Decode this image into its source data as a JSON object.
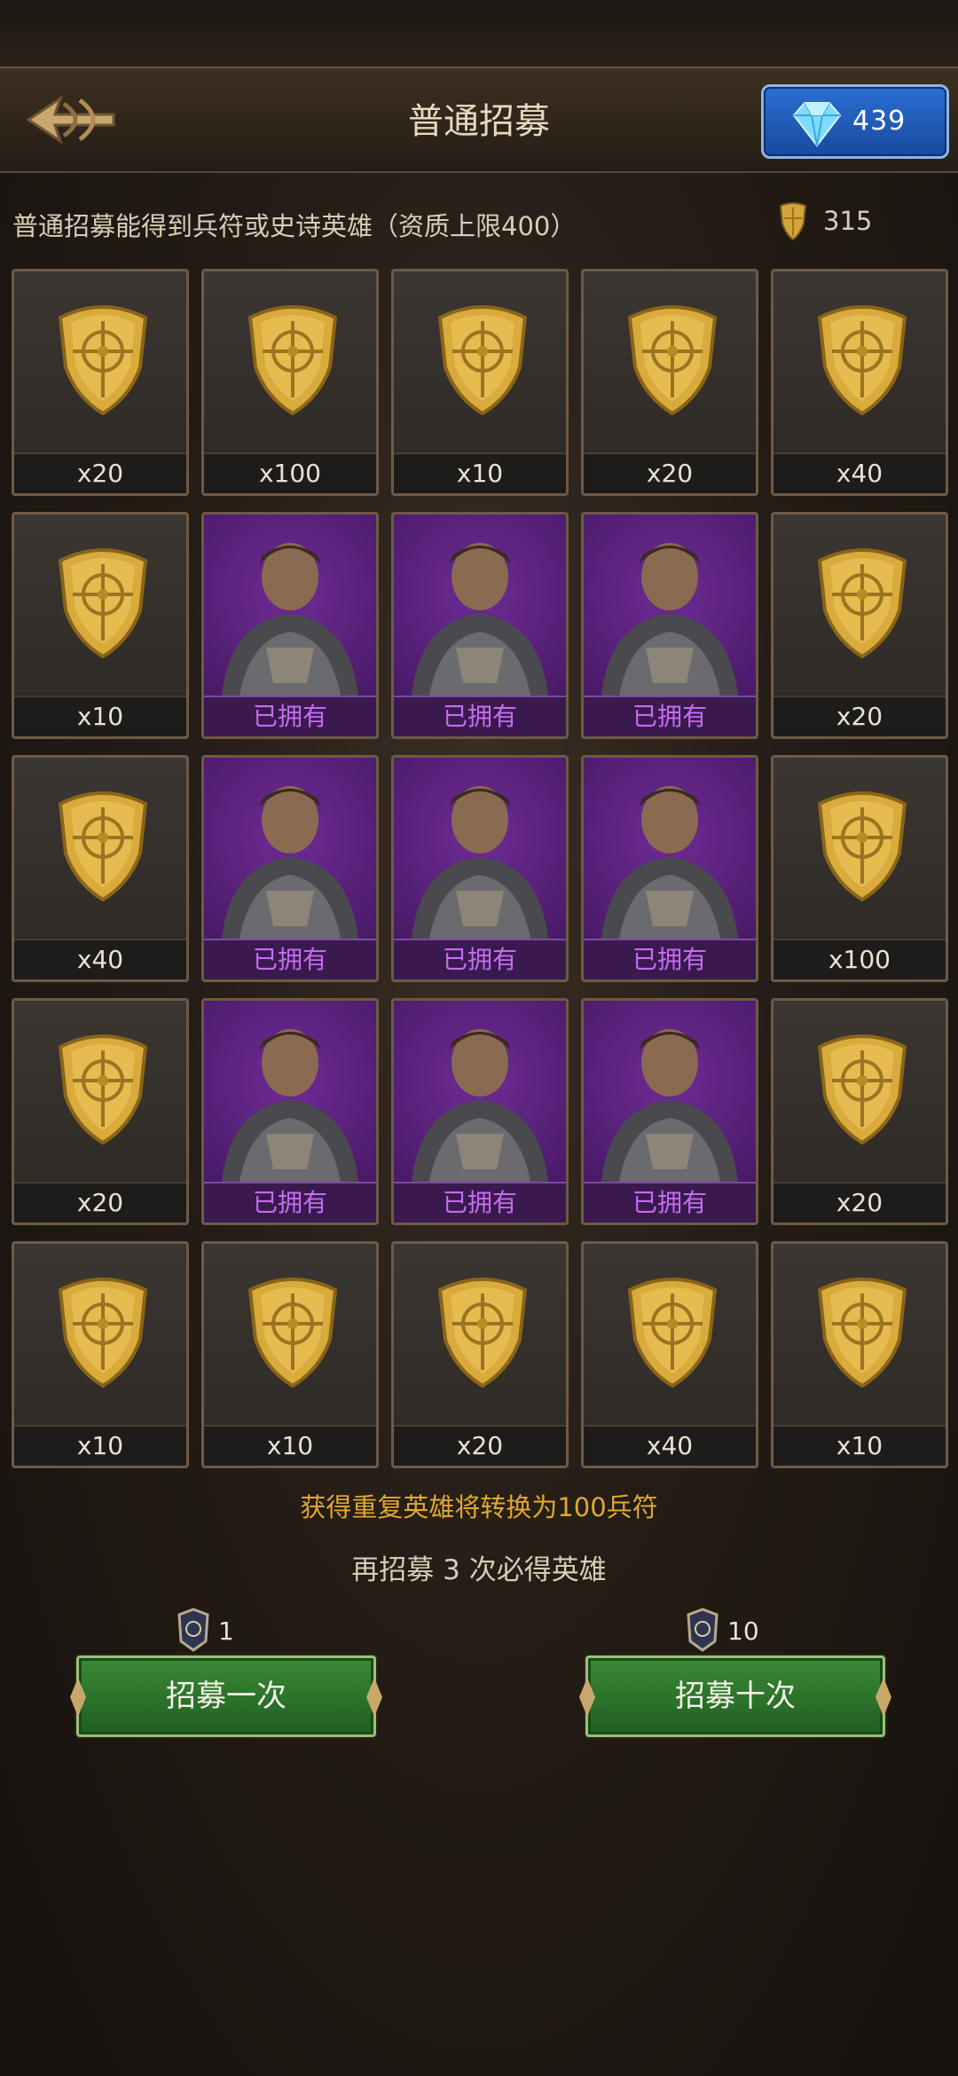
{
  "header": {
    "title": "普通招募",
    "gems": "439"
  },
  "info": {
    "description": "普通招募能得到兵符或史诗英雄（资质上限400）",
    "token_count": "315"
  },
  "grid": {
    "rows": [
      [
        {
          "type": "token",
          "label": "x20"
        },
        {
          "type": "token",
          "label": "x100"
        },
        {
          "type": "token",
          "label": "x10"
        },
        {
          "type": "token",
          "label": "x20"
        },
        {
          "type": "token",
          "label": "x40"
        }
      ],
      [
        {
          "type": "token",
          "label": "x10"
        },
        {
          "type": "hero",
          "label": "已拥有"
        },
        {
          "type": "hero",
          "label": "已拥有"
        },
        {
          "type": "hero",
          "label": "已拥有"
        },
        {
          "type": "token",
          "label": "x20"
        }
      ],
      [
        {
          "type": "token",
          "label": "x40"
        },
        {
          "type": "hero",
          "label": "已拥有"
        },
        {
          "type": "hero",
          "label": "已拥有"
        },
        {
          "type": "hero",
          "label": "已拥有"
        },
        {
          "type": "token",
          "label": "x100"
        }
      ],
      [
        {
          "type": "token",
          "label": "x20"
        },
        {
          "type": "hero",
          "label": "已拥有"
        },
        {
          "type": "hero",
          "label": "已拥有"
        },
        {
          "type": "hero",
          "label": "已拥有"
        },
        {
          "type": "token",
          "label": "x20"
        }
      ],
      [
        {
          "type": "token",
          "label": "x10"
        },
        {
          "type": "token",
          "label": "x10"
        },
        {
          "type": "token",
          "label": "x20"
        },
        {
          "type": "token",
          "label": "x40"
        },
        {
          "type": "token",
          "label": "x10"
        }
      ]
    ]
  },
  "notes": {
    "duplicate": "获得重复英雄将转换为100兵符",
    "pity": "再招募 3 次必得英雄"
  },
  "actions": {
    "once": {
      "cost": "1",
      "label": "招募一次"
    },
    "ten": {
      "cost": "10",
      "label": "招募十次"
    }
  },
  "colors": {
    "gold": "#e0a830",
    "owned_text": "#c46cf0",
    "hero_bg": "#4d1c6c",
    "button_green": "#2e7a2e",
    "gem_blue": "#2b6fd3"
  }
}
